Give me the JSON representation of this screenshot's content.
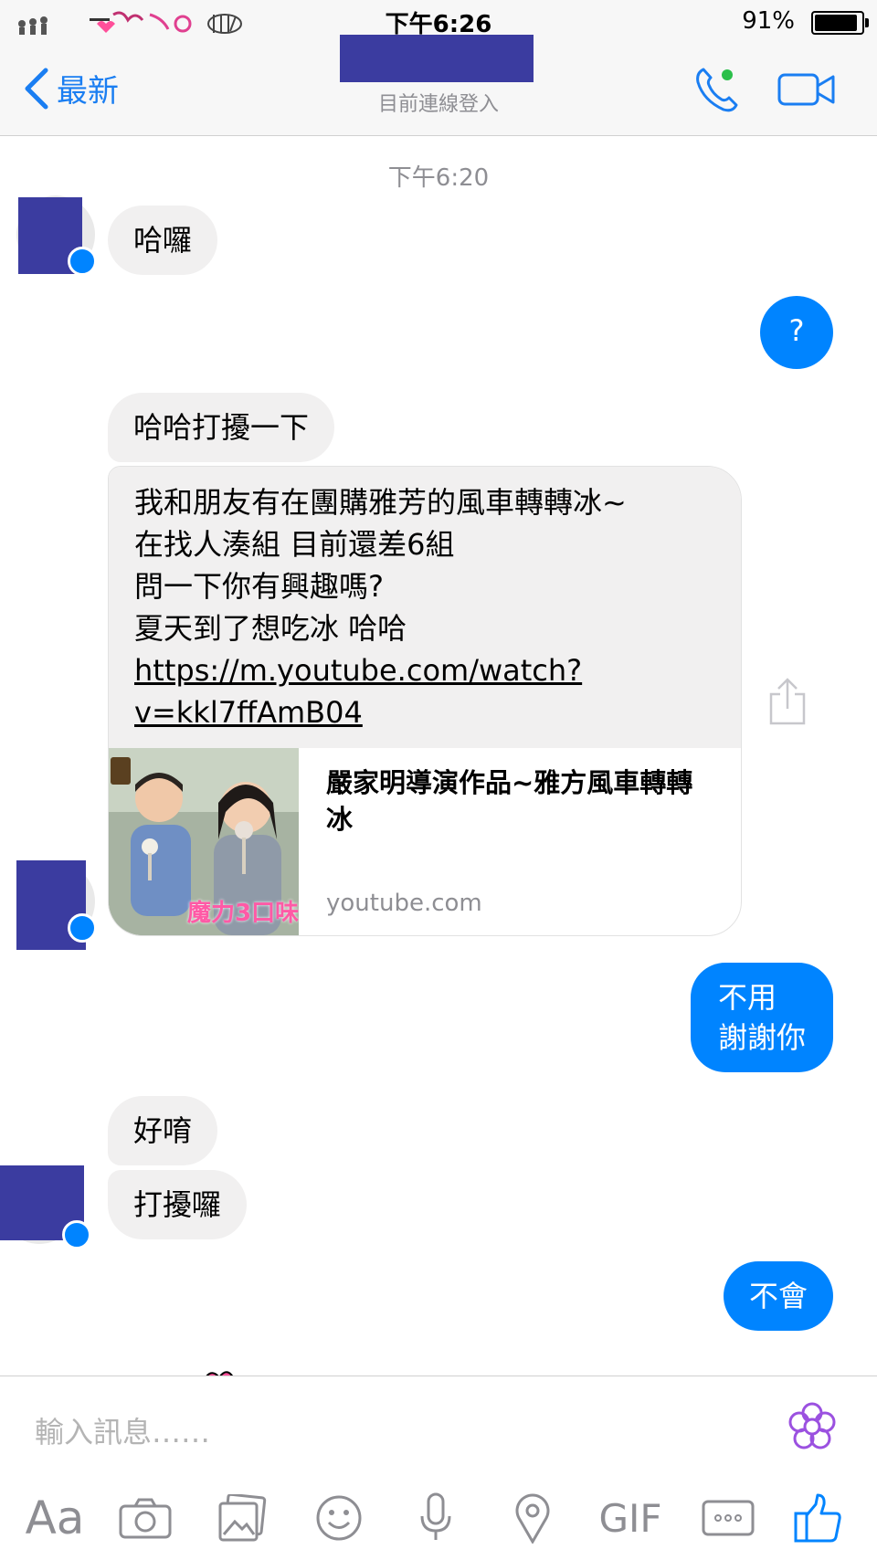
{
  "status_bar": {
    "time": "下午6:26",
    "battery_percent": "91%"
  },
  "nav": {
    "back_label": "最新",
    "subtitle": "目前連線登入"
  },
  "conversation": {
    "timestamp": "下午6:20",
    "messages": [
      {
        "from": "them",
        "text": "哈囉"
      },
      {
        "from": "me",
        "text": "?"
      },
      {
        "from": "them",
        "text": "哈哈打擾一下"
      },
      {
        "from": "them",
        "lines": [
          "我和朋友有在團購雅芳的風車轉轉冰~",
          "在找人湊組 目前還差6組",
          "問一下你有興趣嗎?",
          "夏天到了想吃冰 哈哈"
        ],
        "link": [
          "https://m.youtube.com/watch?",
          "v=kkl7ffAmB04"
        ]
      },
      {
        "from": "me",
        "lines": [
          "不用",
          "謝謝你"
        ]
      },
      {
        "from": "them",
        "text": "好唷"
      },
      {
        "from": "them",
        "text": "打擾囉"
      },
      {
        "from": "me",
        "text": "不會"
      }
    ],
    "link_card": {
      "title": "嚴家明導演作品~雅方風車轉轉冰",
      "domain": "youtube.com",
      "thumb_caption": "魔力3口味"
    }
  },
  "composer": {
    "placeholder": "輸入訊息……",
    "toolbar_text_label": "Aa",
    "toolbar_gif_label": "GIF"
  },
  "colors": {
    "accent": "#0084ff",
    "nav_blue": "#1a7ef2",
    "incoming_bubble": "#f1f0f0",
    "online_green": "#2bbf4a"
  }
}
